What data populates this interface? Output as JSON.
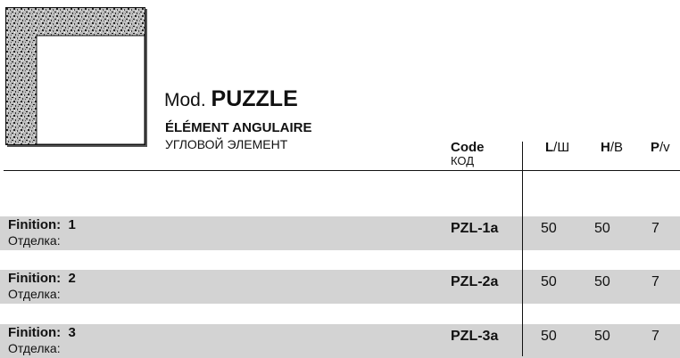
{
  "product": {
    "model_prefix": "Mod.",
    "model_name": "PUZZLE",
    "subtitle_fr": "ÉLÉMENT ANGULAIRE",
    "subtitle_ru": "УГЛОВОЙ ЭЛЕМЕНТ",
    "thumbnail_icon": "corner-element-icon"
  },
  "table": {
    "headers": {
      "code": "Code",
      "code_ru": "КОД",
      "l_bold": "L",
      "l_rest": "/Ш",
      "h_bold": "H",
      "h_rest": "/В",
      "p_bold": "P",
      "p_rest": "/v"
    },
    "rows": [
      {
        "finition_label": "Finition:",
        "finition_num": "1",
        "finition_ru": "Отделка:",
        "code": "PZL-1a",
        "l": "50",
        "h": "50",
        "p": "7"
      },
      {
        "finition_label": "Finition:",
        "finition_num": "2",
        "finition_ru": "Отделка:",
        "code": "PZL-2a",
        "l": "50",
        "h": "50",
        "p": "7"
      },
      {
        "finition_label": "Finition:",
        "finition_num": "3",
        "finition_ru": "Отделка:",
        "code": "PZL-3a",
        "l": "50",
        "h": "50",
        "p": "7"
      }
    ]
  },
  "colors": {
    "row_background": "#d3d3d3",
    "line": "#111111"
  }
}
